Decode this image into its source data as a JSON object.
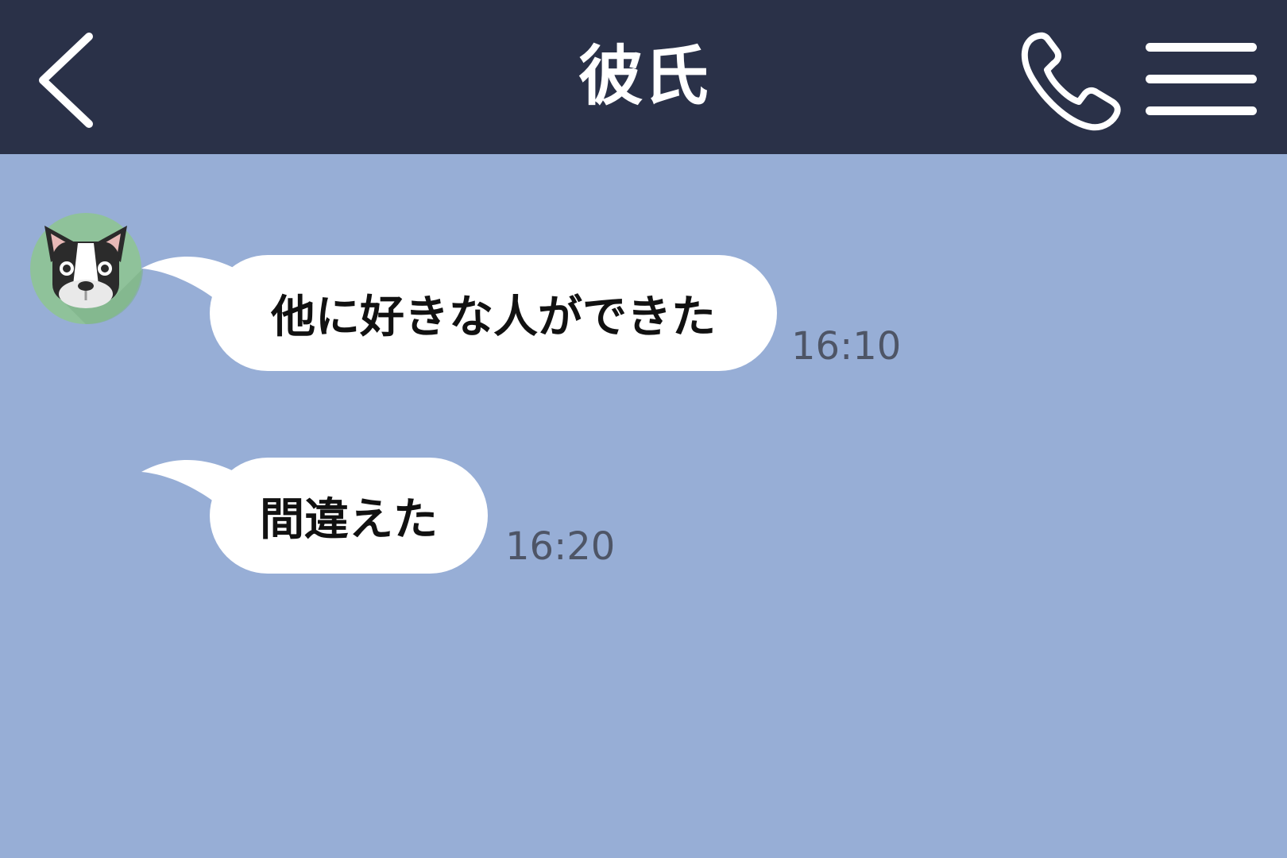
{
  "header": {
    "title": "彼氏",
    "back_icon": "chevron-left-icon",
    "call_icon": "phone-icon",
    "menu_icon": "hamburger-menu-icon",
    "background_color": "#2a3148"
  },
  "chat": {
    "background_color": "#97aed6",
    "contact_avatar": "french-bulldog-icon",
    "messages": [
      {
        "text": "他に好きな人ができた",
        "time": "16:10"
      },
      {
        "text": "間違えた",
        "time": "16:20"
      }
    ]
  }
}
